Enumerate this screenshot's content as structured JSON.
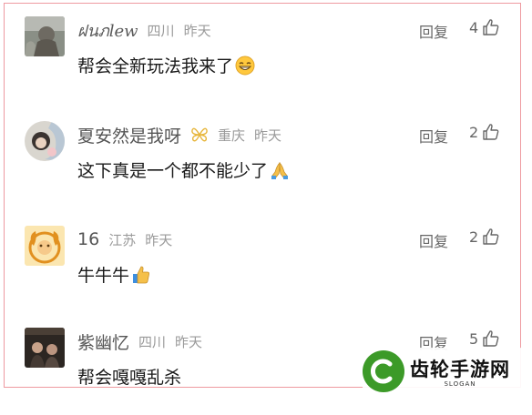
{
  "comments": [
    {
      "username": "ฝนภlew",
      "location": "四川",
      "time": "昨天",
      "text": "帮会全新玩法我来了",
      "emoji": "grin-emoji",
      "reply_label": "回复",
      "likes": "4"
    },
    {
      "username": "夏安然是我呀",
      "location": "重庆",
      "time": "昨天",
      "text": "这下真是一个都不能少了",
      "emoji": "pray-emoji",
      "reply_label": "回复",
      "likes": "2"
    },
    {
      "username": "16",
      "location": "江苏",
      "time": "昨天",
      "text": "牛牛牛",
      "emoji": "thumbs-up-emoji",
      "reply_label": "回复",
      "likes": "2"
    },
    {
      "username": "紫幽忆",
      "location": "四川",
      "time": "昨天",
      "text": "帮会嘎嘎乱杀",
      "emoji": "",
      "reply_label": "回复",
      "likes": "5"
    }
  ],
  "watermark": {
    "title": "齿轮手游网",
    "subtitle": "SLOGAN"
  },
  "colors": {
    "frame_border": "#ee9aa0",
    "meta_gray": "#9a9a9a",
    "badge_gold": "#e7b63c",
    "logo_green": "#3c9a28"
  }
}
